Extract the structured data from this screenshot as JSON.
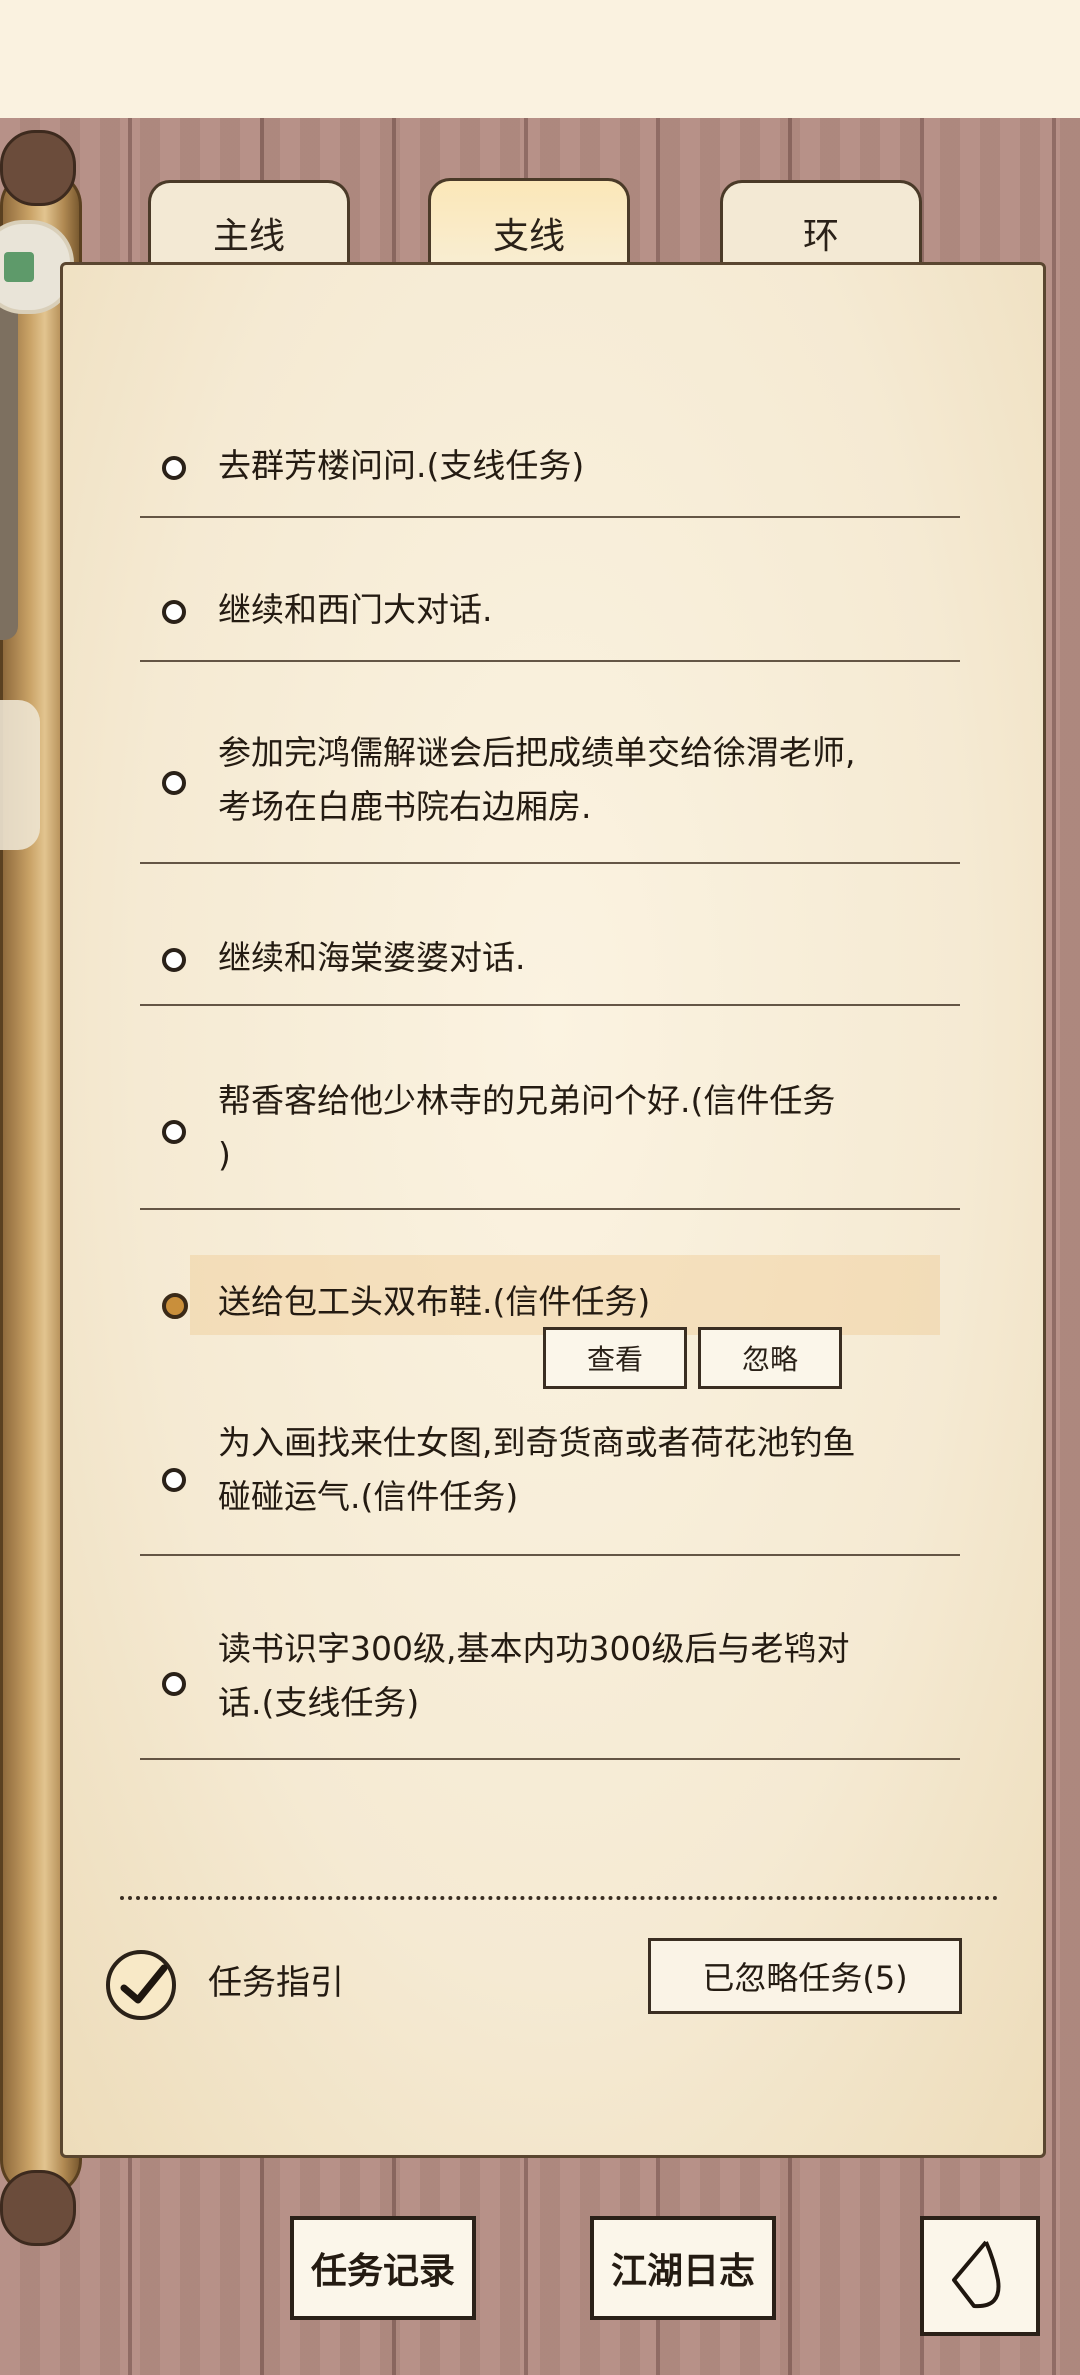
{
  "tabs": {
    "main": "主线",
    "branch": "支线",
    "loop": "环",
    "active": "branch"
  },
  "quests": [
    {
      "lines": [
        "去群芳楼问问.(支线任务)"
      ]
    },
    {
      "lines": [
        "继续和西门大对话."
      ]
    },
    {
      "lines": [
        "参加完鸿儒解谜会后把成绩单交给徐渭老师,",
        "考场在白鹿书院右边厢房."
      ]
    },
    {
      "lines": [
        "继续和海棠婆婆对话."
      ]
    },
    {
      "lines": [
        "帮香客给他少林寺的兄弟问个好.(信件任务",
        ")"
      ]
    },
    {
      "lines": [
        "送给包工头双布鞋.(信件任务)"
      ],
      "selected": true
    },
    {
      "lines": [
        "为入画找来仕女图,到奇货商或者荷花池钓鱼",
        "碰碰运气.(信件任务)"
      ]
    },
    {
      "lines": [
        "读书识字300级,基本内功300级后与老鸨对",
        "话.(支线任务)"
      ]
    }
  ],
  "selected_actions": {
    "view": "查看",
    "ignore": "忽略"
  },
  "footer": {
    "guide_label": "任务指引",
    "guide_checked": true,
    "ignored_button": "已忽略任务(5)"
  },
  "bottom": {
    "record": "任务记录",
    "journal": "江湖日志",
    "back_icon": "back-arrow-icon"
  },
  "colors": {
    "accent": "#c98f3b",
    "paper": "#f8efd8",
    "ink": "#241b12"
  }
}
